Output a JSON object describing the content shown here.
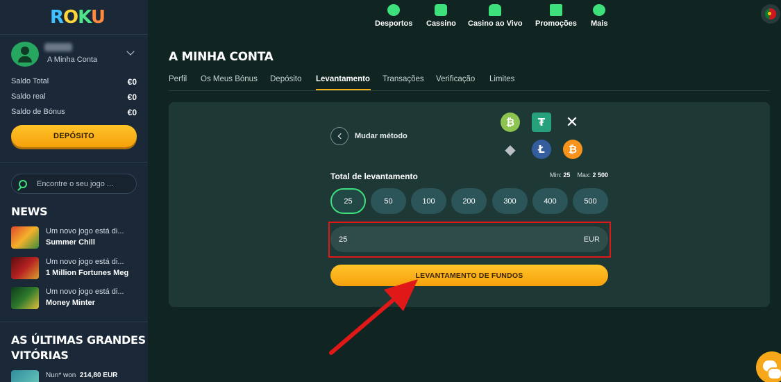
{
  "brand": {
    "logo_letters": [
      "R",
      "O",
      "K",
      "U"
    ]
  },
  "sidebar": {
    "account_label": "A Minha Conta",
    "balances": [
      {
        "label": "Saldo Total",
        "value": "€0"
      },
      {
        "label": "Saldo real",
        "value": "€0"
      },
      {
        "label": "Saldo de Bónus",
        "value": "€0"
      }
    ],
    "deposit_label": "DEPÓSITO",
    "search_placeholder": "Encontre o seu jogo ...",
    "news_title": "NEWS",
    "news": [
      {
        "line1": "Um novo jogo está di...",
        "line2": "Summer Chill"
      },
      {
        "line1": "Um novo jogo está di...",
        "line2": "1 Million Fortunes Meg"
      },
      {
        "line1": "Um novo jogo está di...",
        "line2": "Money Minter"
      }
    ],
    "wins_title_line1": "AS ÚLTIMAS GRANDES",
    "wins_title_line2": "VITÓRIAS",
    "wins": [
      {
        "user": "Nun* won",
        "amount": "214,80 EUR"
      }
    ]
  },
  "topnav": {
    "items": [
      {
        "label": "Desportos",
        "icon": "basketball-icon"
      },
      {
        "label": "Cassino",
        "icon": "slot-machine-icon"
      },
      {
        "label": "Casino ao Vivo",
        "icon": "dealer-icon"
      },
      {
        "label": "Promoções",
        "icon": "gift-icon"
      },
      {
        "label": "Mais",
        "icon": "more-dots-icon"
      }
    ],
    "language_icon": "portugal-flag-icon"
  },
  "account": {
    "title": "A MINHA CONTA",
    "tabs": [
      "Perfil",
      "Os Meus Bónus",
      "Depósito",
      "Levantamento",
      "Transações",
      "Verificação",
      "Limites"
    ],
    "active_tab": "Levantamento"
  },
  "withdraw": {
    "change_method_label": "Mudar método",
    "coins": [
      {
        "name": "bitcoin-cash-icon",
        "glyph": "₿",
        "color": "#8dc351"
      },
      {
        "name": "tether-icon",
        "glyph": "₮",
        "color": "#26a17b"
      },
      {
        "name": "xrp-icon",
        "glyph": "✕",
        "color": "transparent"
      },
      {
        "name": "ethereum-icon",
        "glyph": "◆",
        "color": "transparent"
      },
      {
        "name": "litecoin-icon",
        "glyph": "Ł",
        "color": "#345d9d"
      },
      {
        "name": "bitcoin-icon",
        "glyph": "₿",
        "color": "#f7931a"
      }
    ],
    "amount_label": "Total de levantamento",
    "min_label": "Min:",
    "min_value": "25",
    "max_label": "Max:",
    "max_value": "2 500",
    "presets": [
      "25",
      "50",
      "100",
      "200",
      "300",
      "400",
      "500"
    ],
    "selected_preset": "25",
    "amount_value": "25",
    "currency": "EUR",
    "submit_label": "LEVANTAMENTO DE FUNDOS"
  },
  "colors": {
    "accent_green": "#3ee07b",
    "accent_yellow": "#f6b21a",
    "annotation_red": "#e01818"
  }
}
